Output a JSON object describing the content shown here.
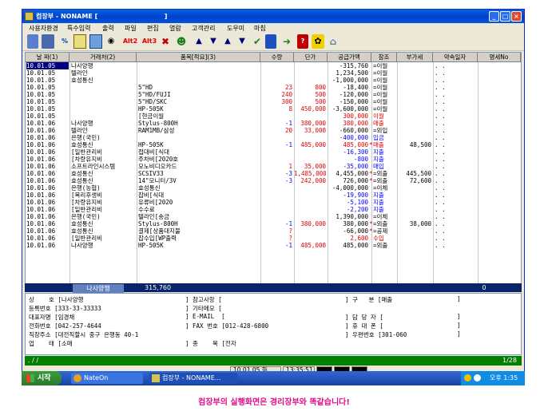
{
  "window": {
    "title": "컴장부 - NONAME [                              ]"
  },
  "menu": [
    "사용자환경",
    "특수입력",
    "출력",
    "파일",
    "편집",
    "열람",
    "고객관리",
    "도우미",
    "마침"
  ],
  "toolbar": {
    "alt2": "Alt2",
    "alt3": "Alt3"
  },
  "grid": {
    "headers": [
      "날  짜(1)",
      "거래처(2)",
      "품목[적요](3)",
      "수량",
      "단가",
      "공급가액",
      "참조",
      "부가세",
      "약속일자",
      "명세No"
    ],
    "rows": [
      {
        "date": "10.01.05",
        "client": "나사양행",
        "item": "",
        "qty": "",
        "price": "",
        "amount": "-315,760",
        "ref": "=이월",
        "vat": "",
        "promise": "  .  .",
        "no": "",
        "amtColor": "black",
        "selected": true
      },
      {
        "date": "10.01.05",
        "client": "텔라인",
        "item": "",
        "qty": "",
        "price": "",
        "amount": "1,234,500",
        "ref": "=이월",
        "vat": "",
        "promise": "  .  .",
        "no": "",
        "amtColor": "black"
      },
      {
        "date": "10.01.05",
        "client": "효성통신",
        "item": "",
        "qty": "",
        "price": "",
        "amount": "-1,000,000",
        "ref": "=이월",
        "vat": "",
        "promise": "  .  .",
        "no": "",
        "amtColor": "black"
      },
      {
        "date": "10.01.05",
        "client": "",
        "item": "5\"HD",
        "qty": "23",
        "price": "800",
        "amount": "-18,400",
        "ref": "=이월",
        "vat": "",
        "promise": "  .  .",
        "no": "",
        "amtColor": "black"
      },
      {
        "date": "10.01.05",
        "client": "",
        "item": "5\"HD/FUJI",
        "qty": "240",
        "price": "500",
        "amount": "-120,000",
        "ref": "=이월",
        "vat": "",
        "promise": "  .  .",
        "no": "",
        "amtColor": "black"
      },
      {
        "date": "10.01.05",
        "client": "",
        "item": "5\"HD/SKC",
        "qty": "300",
        "price": "500",
        "amount": "-150,000",
        "ref": "=이월",
        "vat": "",
        "promise": "  .  .",
        "no": "",
        "amtColor": "black"
      },
      {
        "date": "10.01.05",
        "client": "",
        "item": "HP-505K",
        "qty": "8",
        "price": "450,000",
        "amount": "-3,600,000",
        "ref": "=이월",
        "vat": "",
        "promise": "  .  .",
        "no": "",
        "amtColor": "black"
      },
      {
        "date": "10.01.05",
        "client": "",
        "item": "[현금이월",
        "qty": "",
        "price": "",
        "amount": "300,000",
        "ref": "이월",
        "vat": "",
        "promise": "  .  .",
        "no": "",
        "amtColor": "red"
      },
      {
        "date": "10.01.06",
        "client": "나사양행",
        "item": "Stylus-800H",
        "qty": "-1",
        "price": "380,000",
        "amount": "380,000",
        "ref": "매출",
        "vat": "",
        "promise": "  .  .",
        "no": "",
        "amtColor": "red"
      },
      {
        "date": "10.01.06",
        "client": "텔라인",
        "item": "RAM1MB/삼성",
        "qty": "20",
        "price": "33,000",
        "amount": "-660,000",
        "ref": "=외입",
        "vat": "",
        "promise": "  .  .",
        "no": "",
        "amtColor": "black"
      },
      {
        "date": "10.01.06",
        "client": "은행(국민)",
        "item": "",
        "qty": "",
        "price": "",
        "amount": "-400,000",
        "ref": "입금",
        "vat": "",
        "promise": "  .  .",
        "no": "",
        "amtColor": "blue"
      },
      {
        "date": "10.01.06",
        "client": "효성통신",
        "item": "HP-505K",
        "qty": "-1",
        "price": "485,000",
        "amount": "485,000",
        "ref": "매출",
        "vat": "48,500",
        "promise": "  .  .",
        "no": "",
        "amtColor": "red",
        "star": true
      },
      {
        "date": "10.01.06",
        "client": "[일반관리비",
        "item": "접대비[식대",
        "qty": "",
        "price": "",
        "amount": "-16,300",
        "ref": "지출",
        "vat": "",
        "promise": "  .  .",
        "no": "",
        "amtColor": "blue"
      },
      {
        "date": "10.01.06",
        "client": "[차량유지비",
        "item": "주차비[2020호",
        "qty": "",
        "price": "",
        "amount": "-800",
        "ref": "지출",
        "vat": "",
        "promise": "  .  .",
        "no": "",
        "amtColor": "blue"
      },
      {
        "date": "10.01.06",
        "client": "소프트라인시스템",
        "item": "모노비디오카드",
        "qty": "1",
        "price": "35,000",
        "amount": "-35,000",
        "ref": "매입",
        "vat": "",
        "promise": "  .  .",
        "no": "",
        "amtColor": "blue"
      },
      {
        "date": "10.01.06",
        "client": "효성통신",
        "item": "SCSIV33",
        "qty": "-3",
        "price": "1,485,000",
        "amount": "4,455,000",
        "ref": "=외출",
        "vat": "445,500",
        "promise": "  .  .",
        "no": "",
        "amtColor": "black",
        "star": true
      },
      {
        "date": "10.01.06",
        "client": "효성통신",
        "item": "14\"모니터/3V",
        "qty": "-3",
        "price": "242,000",
        "amount": "726,000",
        "ref": "=외출",
        "vat": "72,600",
        "promise": "  .  .",
        "no": "",
        "amtColor": "black",
        "star": true
      },
      {
        "date": "10.01.06",
        "client": "은행(농협)",
        "item": "효성통신",
        "qty": "",
        "price": "",
        "amount": "-4,000,000",
        "ref": "=이체",
        "vat": "",
        "promise": "  .  .",
        "no": "",
        "amtColor": "black"
      },
      {
        "date": "10.01.06",
        "client": "[복리후생비",
        "item": "잡비[식대",
        "qty": "",
        "price": "",
        "amount": "-19,900",
        "ref": "지출",
        "vat": "",
        "promise": "  .  .",
        "no": "",
        "amtColor": "blue"
      },
      {
        "date": "10.01.06",
        "client": "[차량유지비",
        "item": "유류비[2020",
        "qty": "",
        "price": "",
        "amount": "-5,100",
        "ref": "지출",
        "vat": "",
        "promise": "  .  .",
        "no": "",
        "amtColor": "blue"
      },
      {
        "date": "10.01.06",
        "client": "[일반관리비",
        "item": "수수료",
        "qty": "",
        "price": "",
        "amount": "-2,200",
        "ref": "지출",
        "vat": "",
        "promise": "  .  .",
        "no": "",
        "amtColor": "blue"
      },
      {
        "date": "10.01.06",
        "client": "은행(국민)",
        "item": "텔라인[송금",
        "qty": "",
        "price": "",
        "amount": "1,390,000",
        "ref": "=이체",
        "vat": "",
        "promise": "  .  .",
        "no": "",
        "amtColor": "black"
      },
      {
        "date": "10.01.06",
        "client": "효성통신",
        "item": "Stylus-800H",
        "qty": "-1",
        "price": "380,000",
        "amount": "380,000",
        "ref": "=외출",
        "vat": "38,000",
        "promise": "  .  .",
        "no": "",
        "amtColor": "black",
        "star": true
      },
      {
        "date": "10.01.06",
        "client": "효성통신",
        "item": "결제[상품대지불",
        "qty": "?",
        "price": "",
        "amount": "-66,000",
        "ref": "=공제",
        "vat": "",
        "promise": "  .  .",
        "no": "",
        "amtColor": "black",
        "star": true
      },
      {
        "date": "10.01.06",
        "client": "[일반관리비",
        "item": "잡수입[WP출력",
        "qty": "?",
        "price": "",
        "amount": "2,600",
        "ref": "수입",
        "vat": "",
        "promise": "  .  .",
        "no": "",
        "amtColor": "red"
      },
      {
        "date": "10.01.06",
        "client": "나사양행",
        "item": "HP-505K",
        "qty": "-1",
        "price": "485,000",
        "amount": "485,000",
        "ref": "=외출",
        "vat": "",
        "promise": "  .  .",
        "no": "",
        "amtColor": "black"
      }
    ]
  },
  "summary": {
    "client": "나사양행",
    "balance": "315,760",
    "right_value": "0"
  },
  "info": {
    "company": "상    호 [나사양행",
    "regno": "등록번호 [333-33-33333",
    "rep": "대표자명 [임경채",
    "phone": "전화번호 [042-257-4644",
    "address": "직장주소 [대전직할시 중구 은행동 40-1",
    "biztype": "업    태 [소매",
    "refs": "] 참고사항 [",
    "memo": "] 기타메모 [",
    "email": "] E-MAIL  [",
    "fax": "] FAX 번호 [012-428-6800",
    "item": "] 종    목 [전자",
    "category": "] 구   분 [매출",
    "manager": "] 담 당 자 [",
    "mobile": "] 휴 대 폰 [",
    "zip": "] 우편번호 [301-060"
  },
  "statusbar": {
    "slashes": "    .   /    /",
    "page": "1/28"
  },
  "bottombar": {
    "date": "10.01.05 화",
    "time": "13:35:51"
  },
  "taskbar": {
    "start": "시작",
    "item1": "NateOn",
    "item2": "컴장부 - NONAME...",
    "clock": "오후 1:35"
  },
  "caption": "컴장부의 실행화면은 경리장부와 똑같습니다!",
  "colors": {
    "title_blue": "#0042c8",
    "selected_bg": "#000080",
    "status_green": "#008000",
    "caption_pink": "#e0108a"
  }
}
